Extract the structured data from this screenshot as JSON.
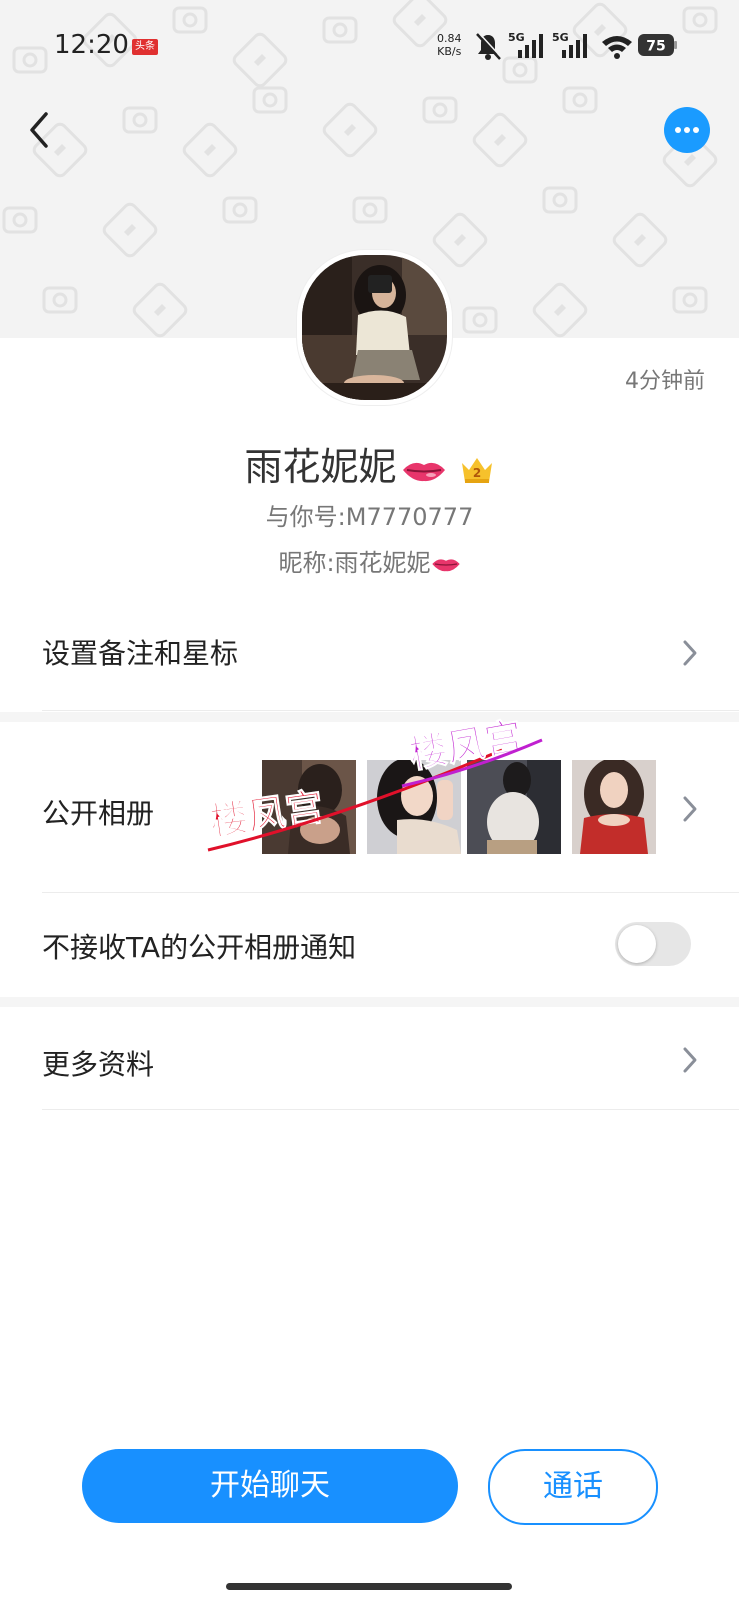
{
  "status_bar": {
    "time": "12:20",
    "app_badge": "头条",
    "net_speed_value": "0.84",
    "net_speed_unit": "KB/s",
    "sim1_label": "5G",
    "sim2_label": "5G",
    "battery": "75"
  },
  "profile": {
    "last_seen": "4分钟前",
    "nickname": "雨花妮妮",
    "level_badge": "2",
    "id_line": "与你号:M7770777",
    "alias_line": "昵称:雨花妮妮"
  },
  "menu": {
    "remark_star": "设置备注和星标",
    "public_album": "公开相册",
    "album_watermark": "楼凤宫",
    "mute_album_notice": "不接收TA的公开相册通知",
    "mute_album_notice_enabled": false,
    "more_info": "更多资料"
  },
  "actions": {
    "start_chat": "开始聊天",
    "call": "通话"
  },
  "colors": {
    "accent": "#1890ff",
    "header_bg": "#f3f3f3",
    "watermark_red": "#e0102a",
    "watermark_magenta": "#c020d0"
  }
}
